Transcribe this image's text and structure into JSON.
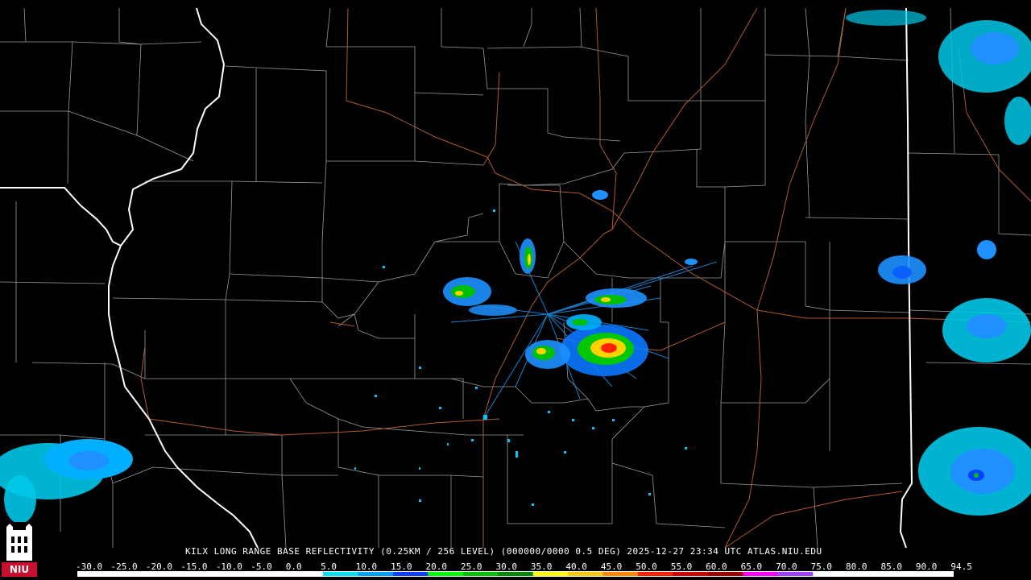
{
  "product": {
    "caption": "KILX LONG RANGE BASE REFLECTIVITY (0.25KM / 256 LEVEL) (000000/0000 0.5 DEG) 2025-12-27 23:34 UTC  ATLAS.NIU.EDU"
  },
  "scale": {
    "labels": [
      "-30.0",
      "-25.0",
      "-20.0",
      "-15.0",
      "-10.0",
      "-5.0",
      "0.0",
      "5.0",
      "10.0",
      "15.0",
      "20.0",
      "25.0",
      "30.0",
      "35.0",
      "40.0",
      "45.0",
      "50.0",
      "55.0",
      "60.0",
      "65.0",
      "70.0",
      "75.0",
      "80.0",
      "85.0",
      "90.0",
      "94.5"
    ],
    "colors": [
      "#ffffff",
      "#ffffff",
      "#ffffff",
      "#ffffff",
      "#ffffff",
      "#ffffff",
      "#ffffff",
      "#00e0ff",
      "#00a0ff",
      "#1040ff",
      "#00ff00",
      "#00c000",
      "#008800",
      "#ffff00",
      "#ffc800",
      "#ff8800",
      "#ff2000",
      "#d00000",
      "#a00000",
      "#ff00ff",
      "#a040ff",
      "#ffffff",
      "#ffffff",
      "#ffffff",
      "#ffffff"
    ]
  },
  "logo": {
    "text": "NIU"
  },
  "colors": {
    "county_lines": "#9a9a9a",
    "state_lines": "#ffffff",
    "highways": "#b05a30"
  }
}
